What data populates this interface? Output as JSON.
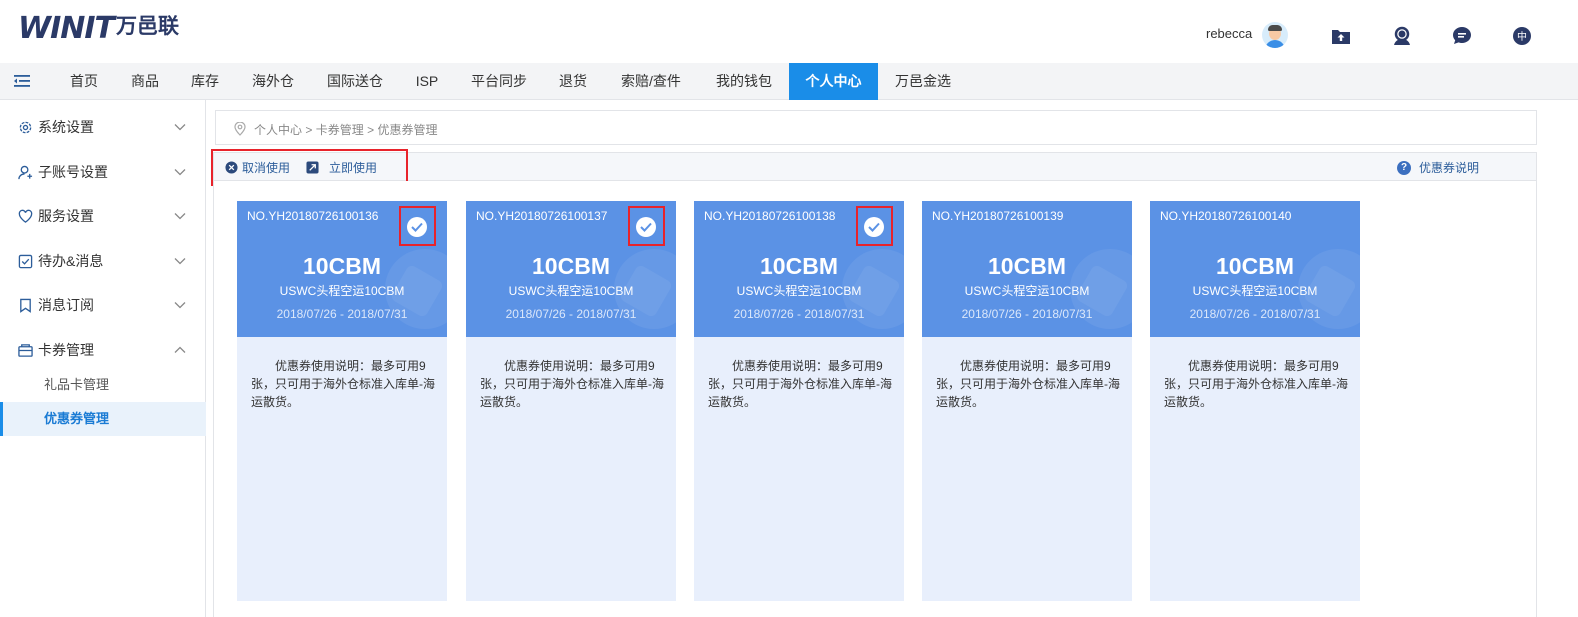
{
  "header": {
    "logo_mark": "WINIT",
    "logo_cn": "万邑联",
    "user_name": "rebecca",
    "icons": [
      "upload-folder-icon",
      "customer-service-icon",
      "message-icon",
      "language-icon"
    ],
    "language_label": "中"
  },
  "nav": {
    "items": [
      {
        "label": "首页"
      },
      {
        "label": "商品"
      },
      {
        "label": "库存"
      },
      {
        "label": "海外仓"
      },
      {
        "label": "国际送仓"
      },
      {
        "label": "ISP"
      },
      {
        "label": "平台同步"
      },
      {
        "label": "退货"
      },
      {
        "label": "索赔/查件"
      },
      {
        "label": "我的钱包"
      },
      {
        "label": "个人中心"
      },
      {
        "label": "万邑金选"
      }
    ],
    "active": "个人中心"
  },
  "sidebar": {
    "items": [
      {
        "label": "系统设置",
        "icon": "gear-icon",
        "expanded": false
      },
      {
        "label": "子账号设置",
        "icon": "user-icon",
        "expanded": false
      },
      {
        "label": "服务设置",
        "icon": "heart-icon",
        "expanded": false
      },
      {
        "label": "待办&消息",
        "icon": "checkbox-icon",
        "expanded": false
      },
      {
        "label": "消息订阅",
        "icon": "bookmark-icon",
        "expanded": false
      },
      {
        "label": "卡券管理",
        "icon": "card-icon",
        "expanded": true
      }
    ],
    "sub_items": [
      {
        "label": "礼品卡管理",
        "active": false
      },
      {
        "label": "优惠券管理",
        "active": true
      }
    ]
  },
  "breadcrumb": {
    "items": [
      "个人中心",
      "卡券管理",
      "优惠券管理"
    ],
    "separator": ">"
  },
  "toolbar": {
    "cancel_label": "取消使用",
    "use_label": "立即使用",
    "help_label": "优惠券说明",
    "help_icon": "?"
  },
  "coupons": [
    {
      "no": "NO.YH20180726100136",
      "amount": "10CBM",
      "name": "USWC头程空运10CBM",
      "date": "2018/07/26 - 2018/07/31",
      "desc": "优惠券使用说明：最多可用9张，只可用于海外仓标准入库单-海运散货。",
      "selected": true
    },
    {
      "no": "NO.YH20180726100137",
      "amount": "10CBM",
      "name": "USWC头程空运10CBM",
      "date": "2018/07/26 - 2018/07/31",
      "desc": "优惠券使用说明：最多可用9张，只可用于海外仓标准入库单-海运散货。",
      "selected": true
    },
    {
      "no": "NO.YH20180726100138",
      "amount": "10CBM",
      "name": "USWC头程空运10CBM",
      "date": "2018/07/26 - 2018/07/31",
      "desc": "优惠券使用说明：最多可用9张，只可用于海外仓标准入库单-海运散货。",
      "selected": true
    },
    {
      "no": "NO.YH20180726100139",
      "amount": "10CBM",
      "name": "USWC头程空运10CBM",
      "date": "2018/07/26 - 2018/07/31",
      "desc": "优惠券使用说明：最多可用9张，只可用于海外仓标准入库单-海运散货。",
      "selected": false
    },
    {
      "no": "NO.YH20180726100140",
      "amount": "10CBM",
      "name": "USWC头程空运10CBM",
      "date": "2018/07/26 - 2018/07/31",
      "desc": "优惠券使用说明：最多可用9张，只可用于海外仓标准入库单-海运散货。",
      "selected": false
    }
  ],
  "colors": {
    "primary": "#1a8de8",
    "coupon_top": "#5b92e5",
    "coupon_bottom": "#e8effc",
    "highlight": "#e8232b",
    "logo": "#2b3a67"
  }
}
